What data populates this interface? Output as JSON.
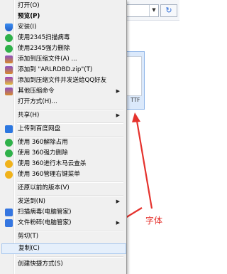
{
  "file": {
    "label": "TTF"
  },
  "annotation": {
    "text": "字体",
    "color": "#e5322d"
  },
  "menu": {
    "items": [
      {
        "label": "打开(O)"
      },
      {
        "label": "预览(P)"
      },
      {
        "label": "安装(I)",
        "icon": "shield-icon"
      },
      {
        "label": "使用2345扫描病毒",
        "icon": "2345-scan-icon"
      },
      {
        "label": "使用2345强力删除",
        "icon": "2345-delete-icon"
      },
      {
        "label": "添加到压缩文件(A) ...",
        "icon": "archive-icon"
      },
      {
        "label": "添加到 \"ARLRDBD.zip\"(T)",
        "icon": "archive-icon"
      },
      {
        "label": "添加到压缩文件并发送给QQ好友",
        "icon": "archive-icon"
      },
      {
        "label": "其他压缩命令",
        "icon": "archive-icon",
        "submenu": true
      },
      {
        "label": "打开方式(H)..."
      },
      {
        "label": "共享(H)",
        "submenu": true
      },
      {
        "label": "上传到百度网盘",
        "icon": "baidu-cloud-icon"
      },
      {
        "label": "使用 360解除占用",
        "icon": "360-unlock-icon"
      },
      {
        "label": "使用 360强力删除",
        "icon": "360-delete-icon"
      },
      {
        "label": "使用 360进行木马云查杀",
        "icon": "360-scan-icon"
      },
      {
        "label": "使用 360管理右键菜单",
        "icon": "360-manage-icon"
      },
      {
        "label": "还原以前的版本(V)"
      },
      {
        "label": "发送到(N)",
        "submenu": true
      },
      {
        "label": "扫描病毒(电脑管家)",
        "icon": "qq-manager-icon"
      },
      {
        "label": "文件粉碎(电脑管家)",
        "icon": "qq-manager-icon",
        "submenu": true
      },
      {
        "label": "剪切(T)"
      },
      {
        "label": "复制(C)"
      },
      {
        "label": "创建快捷方式(S)"
      }
    ]
  }
}
